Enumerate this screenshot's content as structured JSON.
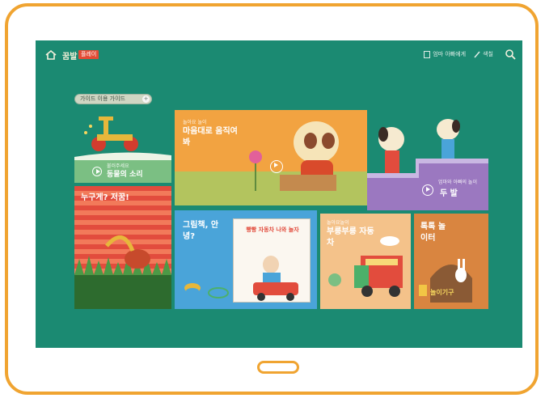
{
  "topbar": {
    "logo": "꿈발",
    "badge": "플레이",
    "link1": "엄마 아빠에게",
    "link2": "색칠",
    "home_icon": "home-icon",
    "search_icon": "search-icon"
  },
  "pill": {
    "label": "가이드 이용 가이드",
    "icon": "+"
  },
  "tiles": {
    "tile1": {
      "small": "불러주세요",
      "title": "동물의 소리",
      "color": "#7bbf83"
    },
    "tile2": {
      "small": "놀아요 놀이",
      "title": "마음대로 움직여 봐",
      "color": "#f2a341"
    },
    "tile3": {
      "small": "엄마와 아빠의 놀이",
      "title": "두 발",
      "color": "#9b78c0"
    },
    "tile4": {
      "title": "누구게? 저꿈!",
      "color": "#e24c3d"
    },
    "tile5": {
      "title": "그림책, 안녕?",
      "color": "#4aa4d9",
      "book_title": "빵빵 자동차 나와 놀자"
    },
    "tile6": {
      "small": "놀아요놀이",
      "title": "부릉부릉 자동차",
      "color": "#f4c28a"
    },
    "tile7": {
      "title": "톡톡 놀이터",
      "color": "#d98540",
      "sub": "놀이기구"
    }
  }
}
